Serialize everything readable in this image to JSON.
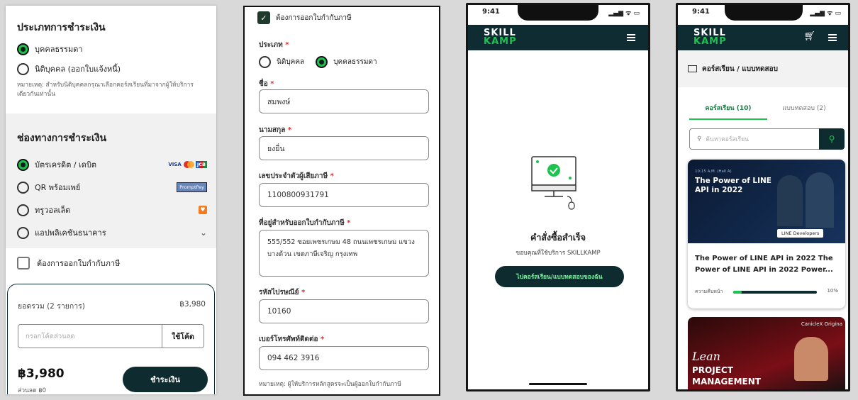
{
  "colors": {
    "accent_green": "#1ec24e",
    "dark_teal": "#0e2c2f",
    "header": "#0f2c33"
  },
  "checkout": {
    "customer_type_title": "ประเภทการชำระเงิน",
    "opt_person": "บุคคลธรรมดา",
    "opt_company": "นิติบุคคล (ออกใบแจ้งหนี้)",
    "note": "หมายเหตุ: สำหรับนิติบุคคลกรุณาเลือกคอร์สเรียนที่มาจากผู้ให้บริการเดียวกันเท่านั้น",
    "payment_title": "ช่องทางการชำระเงิน",
    "methods": [
      {
        "label": "บัตรเครดิต / เดบิต",
        "icon": "card-brands-icon"
      },
      {
        "label": "QR พร้อมเพย์",
        "icon": "promptpay-icon"
      },
      {
        "label": "ทรูวอลเล็ต",
        "icon": "truemoney-icon"
      },
      {
        "label": "แอปพลิเคชันธนาคาร",
        "icon": "chevron-down-icon"
      }
    ],
    "tax_invoice": "ต้องการออกใบกำกับภาษี",
    "total_label": "ยอดรวม (2 รายการ)",
    "total_value": "฿3,980",
    "discount_placeholder": "กรอกโค้ดส่วนลด",
    "apply_code": "ใช้โค้ด",
    "grand_total": "฿3,980",
    "discount_line": "ส่วนลด ฿0",
    "pay_button": "ชำระเงิน",
    "visa": "VISA",
    "jcb": "JCB",
    "promptpay": "PromptPay"
  },
  "taxform": {
    "checkbox_label": "ต้องการออกใบกำกับภาษี",
    "type_label": "ประเภท",
    "type_company": "นิติบุคคล",
    "type_person": "บุคคลธรรมดา",
    "first_name_label": "ชื่อ",
    "first_name": "สมพงษ์",
    "last_name_label": "นามสกุล",
    "last_name": "ยงยื่น",
    "tax_id_label": "เลขประจำตัวผู้เสียภาษี",
    "tax_id": "1100800931791",
    "address_label": "ที่อยู่สำหรับออกใบกำกับภาษี",
    "address": "555/552 ซอยเพชรเกษม 48 ถนนเพชรเกษม แขวงบางด้วน เขตภาษีเจริญ กรุงเทพ",
    "zip_label": "รหัสไปรษณีย์",
    "zip": "10160",
    "phone_label": "เบอร์โทรศัพท์ติดต่อ",
    "phone": "094 462 3916",
    "footnote": "หมายเหตุ: ผู้ให้บริการหลักสูตรจะเป็นผู้ออกใบกำกับภาษี",
    "required_mark": "*"
  },
  "success": {
    "time": "9:41",
    "logo_top": "SKILL",
    "logo_bottom": "KAMP",
    "title": "คำสั่งซื้อสำเร็จ",
    "subtitle": "ขอบคุณที่ใช้บริการ SKILLKAMP",
    "button": "ไปคอร์สเรียน/แบบทดสอบของฉัน"
  },
  "courses": {
    "time": "9:41",
    "logo_top": "SKILL",
    "logo_bottom": "KAMP",
    "breadcrumb": "คอร์สเรียน / แบบทดสอบ",
    "tab_courses": "คอร์สเรียน (10)",
    "tab_tests": "แบบทดสอบ (2)",
    "search_placeholder": "ค้นหาคอร์สเรียน",
    "card1": {
      "banner_tag": "10:15 A.M. (Hall A)",
      "banner_title": "The Power of LINE API in 2022",
      "banner_badge": "LINE Developers",
      "title": "The Power of LINE API in 2022 The Power of LINE API in 2022 Power...",
      "progress_label": "ความคืบหน้า",
      "progress_value": 0.1,
      "progress_text": "10%"
    },
    "card2": {
      "brand": "CanicleX Origina",
      "title_line1": "Lean",
      "title_line2": "PROJECT",
      "title_line3": "MANAGEMENT"
    }
  }
}
